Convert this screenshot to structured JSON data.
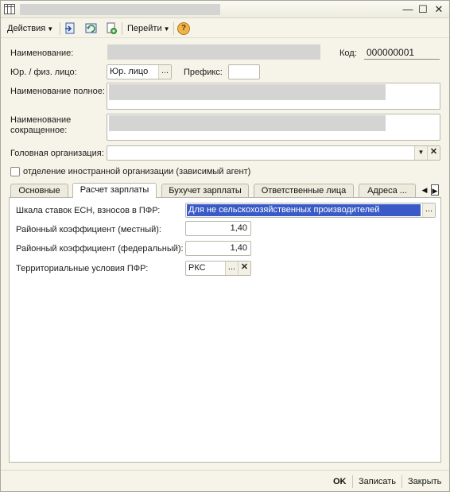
{
  "window": {
    "controls": {
      "minimize": "—",
      "maximize": "☐",
      "close": "✕"
    }
  },
  "toolbar": {
    "actions_label": "Действия",
    "goto_label": "Перейти",
    "help_glyph": "?"
  },
  "form": {
    "name_label": "Наименование:",
    "code_label": "Код:",
    "code_value": "000000001",
    "legal_type_label": "Юр. / физ. лицо:",
    "legal_type_value": "Юр. лицо",
    "prefix_label": "Префикс:",
    "prefix_value": "",
    "full_name_label": "Наименование полное:",
    "short_name_label_1": "Наименование",
    "short_name_label_2": "сокращенное:",
    "head_org_label": "Головная организация:",
    "head_org_value": "",
    "foreign_branch_label": "отделение иностранной организации (зависимый агент)"
  },
  "tabs": [
    {
      "label": "Основные"
    },
    {
      "label": "Расчет зарплаты"
    },
    {
      "label": "Бухучет зарплаты"
    },
    {
      "label": "Ответственные лица"
    },
    {
      "label": "Адреса ..."
    }
  ],
  "payroll": {
    "esn_scale_label": "Шкала ставок ЕСН, взносов в ПФР:",
    "esn_scale_value": "Для не сельскохозяйственных производителей",
    "local_coef_label": "Районный коэффициент (местный):",
    "local_coef_value": "1,40",
    "federal_coef_label": "Районный коэффициент (федеральный):",
    "federal_coef_value": "1,40",
    "pfr_conditions_label": "Территориальные условия ПФР:",
    "pfr_conditions_value": "РКС"
  },
  "footer": {
    "ok_label": "OK",
    "save_label": "Записать",
    "close_label": "Закрыть"
  },
  "colors": {
    "window_bg": "#f6f4e8",
    "selection": "#3a5bc7",
    "redacted": "#d4d4d2"
  }
}
